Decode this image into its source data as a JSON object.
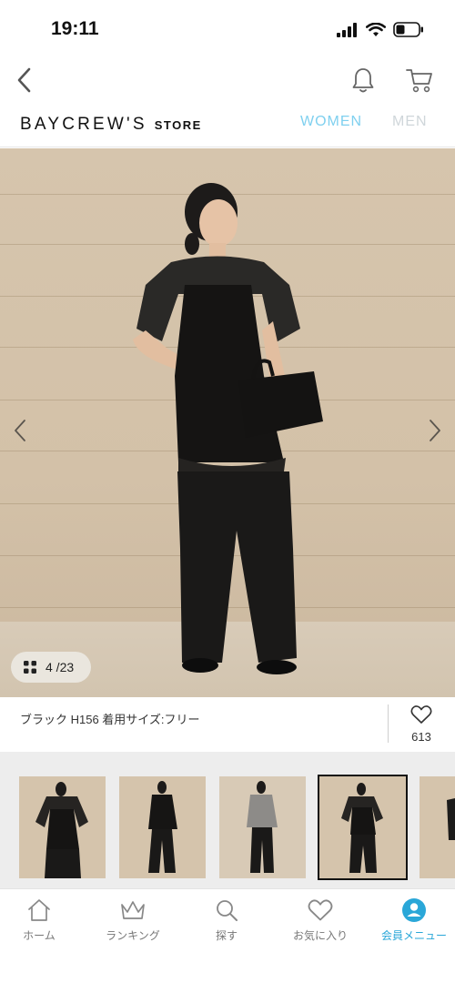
{
  "status": {
    "time": "19:11"
  },
  "brand": {
    "name": "BAYCREW'S",
    "sub": "STORE"
  },
  "gender_tabs": {
    "women": "WOMEN",
    "men": "MEN"
  },
  "gallery": {
    "counter": "4 /23"
  },
  "item": {
    "caption": "ブラック H156 着用サイズ:フリー",
    "favorite_count": "613"
  },
  "bottom_nav": [
    {
      "label": "ホーム",
      "icon": "home-icon"
    },
    {
      "label": "ランキング",
      "icon": "crown-icon"
    },
    {
      "label": "探す",
      "icon": "search-icon"
    },
    {
      "label": "お気に入り",
      "icon": "heart-icon"
    },
    {
      "label": "会員メニュー",
      "icon": "account-icon"
    }
  ],
  "colors": {
    "accent": "#2aa7d8",
    "women_tab": "#7fd0ef",
    "men_tab": "#cfd6da"
  }
}
